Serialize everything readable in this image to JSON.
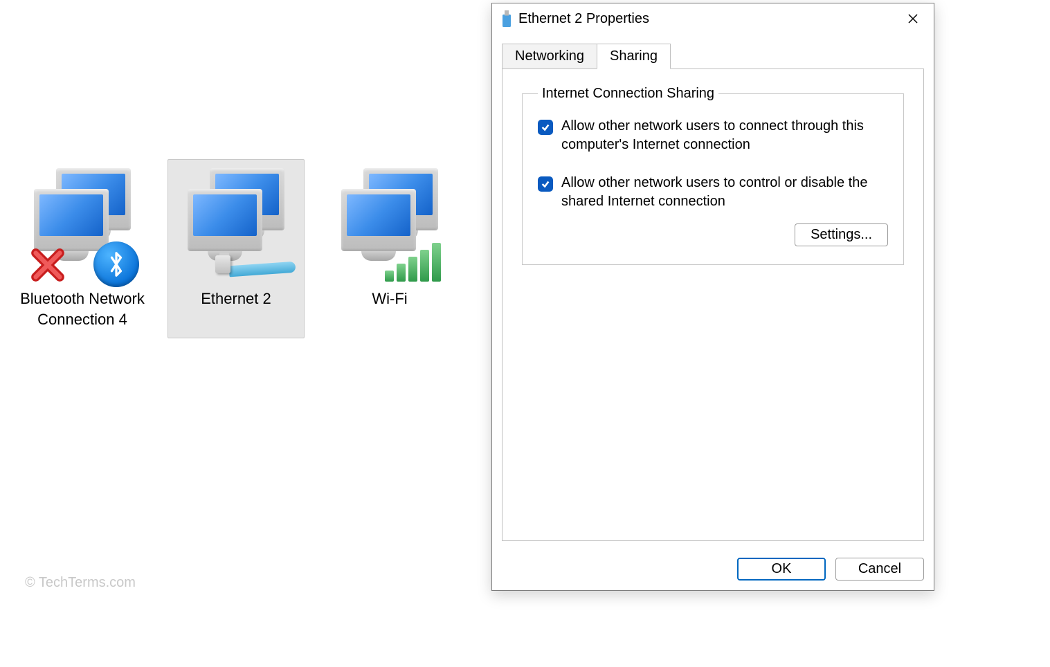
{
  "connections": [
    {
      "id": "bt",
      "label": "Bluetooth Network Connection 4",
      "selected": false
    },
    {
      "id": "eth2",
      "label": "Ethernet 2",
      "selected": true
    },
    {
      "id": "wifi",
      "label": "Wi-Fi",
      "selected": false
    }
  ],
  "dialog": {
    "title": "Ethernet 2 Properties",
    "tabs": [
      {
        "id": "networking",
        "label": "Networking",
        "active": false
      },
      {
        "id": "sharing",
        "label": "Sharing",
        "active": true
      }
    ],
    "sharing": {
      "group_title": "Internet Connection Sharing",
      "check_allow_connect": {
        "checked": true,
        "label": "Allow other network users to connect through this computer's Internet connection"
      },
      "check_allow_control": {
        "checked": true,
        "label": "Allow other network users to control or disable the shared Internet connection"
      },
      "settings_button": "Settings..."
    },
    "buttons": {
      "ok": "OK",
      "cancel": "Cancel"
    }
  },
  "watermark": "© TechTerms.com"
}
